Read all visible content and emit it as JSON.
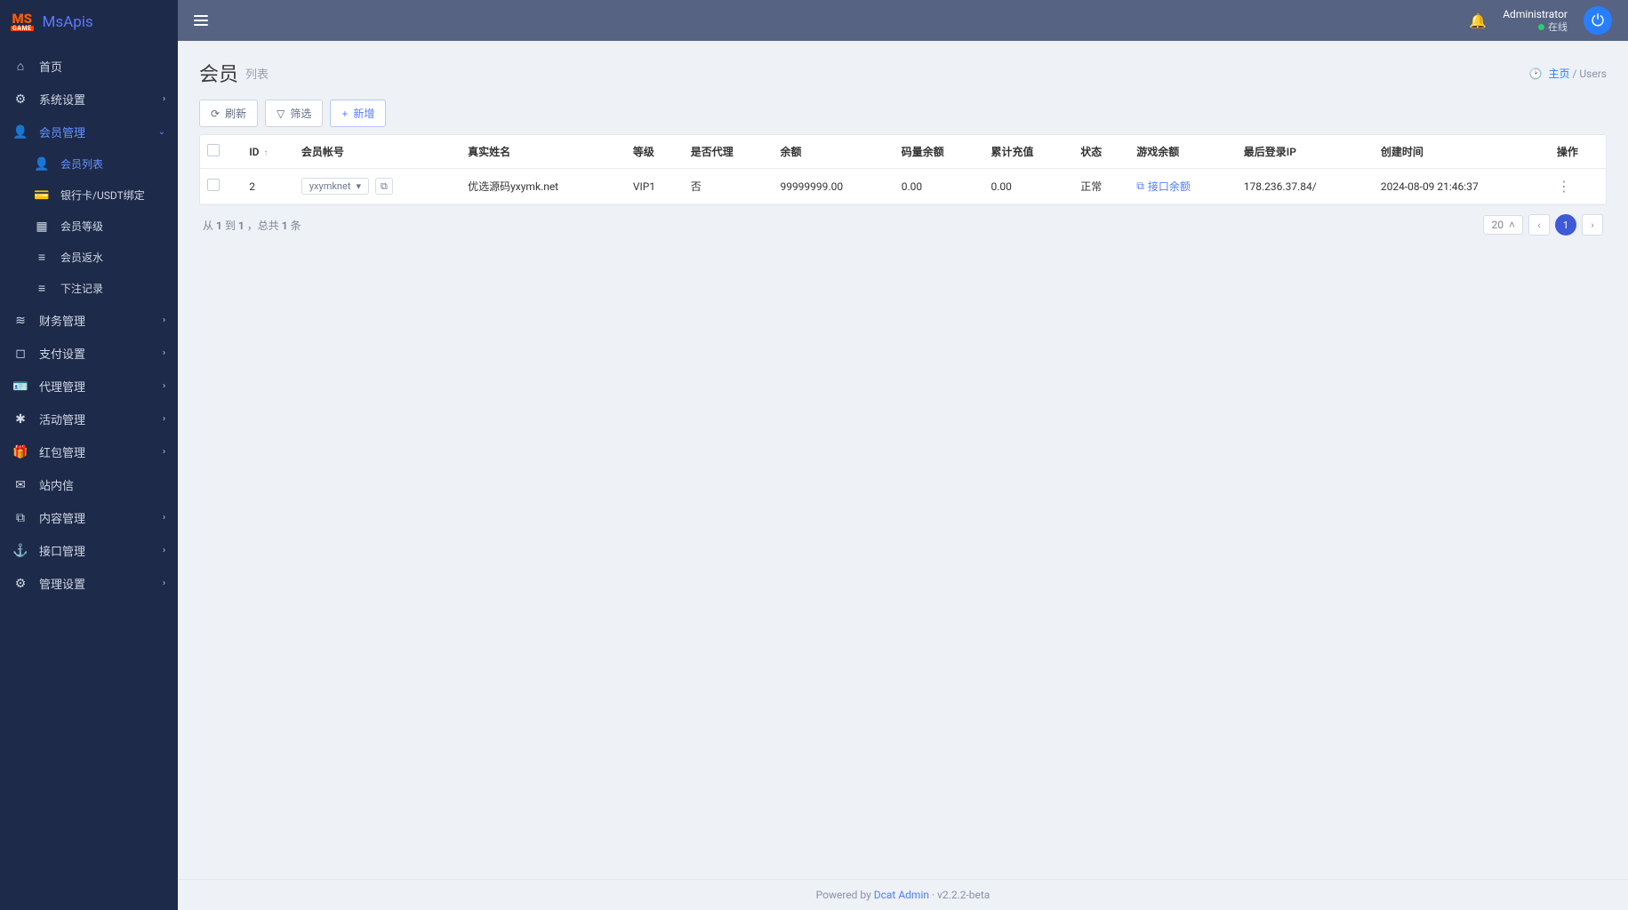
{
  "brand": {
    "logo_top": "MS",
    "logo_bottom": "GAME",
    "name": "MsApis"
  },
  "sidebar": {
    "items": [
      {
        "icon": "home",
        "label": "首页",
        "type": "item"
      },
      {
        "icon": "cogs",
        "label": "系统设置",
        "type": "group"
      },
      {
        "icon": "user",
        "label": "会员管理",
        "type": "group",
        "active": true,
        "open": true,
        "sub": [
          {
            "icon": "user",
            "label": "会员列表",
            "active": true
          },
          {
            "icon": "card",
            "label": "银行卡/USDT绑定"
          },
          {
            "icon": "grid",
            "label": "会员等级"
          },
          {
            "icon": "lines",
            "label": "会员返水"
          },
          {
            "icon": "lines",
            "label": "下注记录"
          }
        ]
      },
      {
        "icon": "db",
        "label": "财务管理",
        "type": "group"
      },
      {
        "icon": "bookmark",
        "label": "支付设置",
        "type": "group"
      },
      {
        "icon": "id",
        "label": "代理管理",
        "type": "group"
      },
      {
        "icon": "star",
        "label": "活动管理",
        "type": "group"
      },
      {
        "icon": "gift",
        "label": "红包管理",
        "type": "group"
      },
      {
        "icon": "mail",
        "label": "站内信",
        "type": "item"
      },
      {
        "icon": "copy",
        "label": "内容管理",
        "type": "group"
      },
      {
        "icon": "anchor",
        "label": "接口管理",
        "type": "group"
      },
      {
        "icon": "gear",
        "label": "管理设置",
        "type": "group"
      }
    ]
  },
  "topbar": {
    "user": "Administrator",
    "status": "在线"
  },
  "page": {
    "title": "会员",
    "subtitle": "列表"
  },
  "breadcrumb": {
    "home": "主页",
    "current": "Users"
  },
  "toolbar": {
    "refresh": "刷新",
    "filter": "筛选",
    "add": "新增"
  },
  "table": {
    "headers": [
      "",
      "ID",
      "会员帐号",
      "真实姓名",
      "等级",
      "是否代理",
      "余额",
      "码量余额",
      "累计充值",
      "状态",
      "游戏余额",
      "最后登录IP",
      "创建时间",
      "操作"
    ],
    "rows": [
      {
        "id": "2",
        "account": "yxymknet",
        "realname": "优选源码yxymk.net",
        "level": "VIP1",
        "is_agent": "否",
        "balance": "99999999.00",
        "code_balance": "0.00",
        "total_recharge": "0.00",
        "status": "正常",
        "game_balance_label": "接口余额",
        "last_ip": "178.236.37.84/",
        "created_at": "2024-08-09 21:46:37"
      }
    ]
  },
  "pagination": {
    "summary_prefix": "从 ",
    "from": "1",
    "mid": " 到 ",
    "to": "1",
    "total_prefix": " ，总共 ",
    "total": "1",
    "total_suffix": " 条",
    "page_size": "20",
    "current": "1"
  },
  "footer": {
    "powered": "Powered by ",
    "product": "Dcat Admin",
    "sep": " · ",
    "version": "v2.2.2-beta"
  },
  "icons": {
    "home": "⌂",
    "cogs": "⚙",
    "user": "👤",
    "card": "💳",
    "grid": "▦",
    "lines": "≡",
    "db": "≋",
    "bookmark": "◻",
    "id": "🪪",
    "star": "✱",
    "gift": "🎁",
    "mail": "✉",
    "copy": "⧉",
    "anchor": "⚓",
    "gear": "⚙",
    "bell": "🔔",
    "power": "⏻",
    "dash": "🕑",
    "refresh": "⟳",
    "filter": "▽",
    "plus": "+",
    "sort": "↑",
    "chev_down": "▾",
    "chev_left": "‹",
    "chev_right": "›",
    "more": "⋮"
  }
}
